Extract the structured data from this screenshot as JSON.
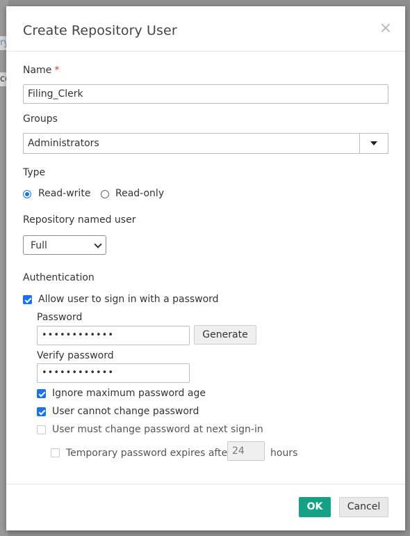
{
  "dialog": {
    "title": "Create Repository User",
    "close_glyph": "×"
  },
  "background": {
    "fragment_1": "ry",
    "fragment_2": "co"
  },
  "name_field": {
    "label": "Name",
    "required_mark": "*",
    "value": "Filing_Clerk"
  },
  "groups": {
    "label": "Groups",
    "selected": "Administrators"
  },
  "type": {
    "label": "Type",
    "options": [
      {
        "label": "Read-write",
        "selected": true
      },
      {
        "label": "Read-only",
        "selected": false
      }
    ]
  },
  "named_user": {
    "label": "Repository named user",
    "selected": "Full"
  },
  "authentication": {
    "label": "Authentication",
    "allow_password_label": "Allow user to sign in with a password",
    "allow_password_checked": true,
    "password_label": "Password",
    "password_value": "••••••••••••",
    "generate_label": "Generate",
    "verify_label": "Verify password",
    "verify_value": "••••••••••••",
    "ignore_max_age_label": "Ignore maximum password age",
    "ignore_max_age_checked": true,
    "cannot_change_label": "User cannot change password",
    "cannot_change_checked": true,
    "must_change_label": "User must change password at next sign-in",
    "must_change_checked": false,
    "temp_expires_label": "Temporary password expires after",
    "temp_expires_value": "24",
    "temp_expires_unit": "hours",
    "temp_expires_checked": false
  },
  "footer": {
    "ok_label": "OK",
    "cancel_label": "Cancel"
  },
  "colors": {
    "accent": "#1a73e8",
    "ok_button": "#16a085",
    "required": "#d83a3a"
  }
}
